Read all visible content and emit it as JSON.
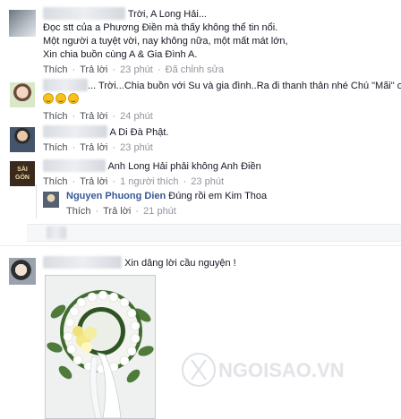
{
  "colors": {
    "link": "#365899",
    "meta": "#90949c",
    "action": "#4b4f56",
    "text": "#141823"
  },
  "comments": [
    {
      "lines": [
        "Trời, A Long Hải...",
        "Đọc stt của a Phương Điền mà thấy không thể tin nổi.",
        "Một người a tuyệt vời, nay không nữa, một mất mát lớn,",
        "Xin chia buồn cùng A & Gia Đình A."
      ],
      "like": "Thích",
      "reply": "Trả lời",
      "time": "23 phút",
      "edited": "Đã chỉnh sửa"
    },
    {
      "name_suffix": "...",
      "text": "Trời...Chia buồn với Su và gia đình..Ra đi thanh thản nhé Chú \"Mãi\" ơi",
      "emoji": [
        "laughing-emoji",
        "laughing-emoji",
        "laughing-emoji"
      ],
      "like": "Thích",
      "reply": "Trả lời",
      "time": "24 phút"
    },
    {
      "text": "A Di Đà Phật.",
      "like": "Thích",
      "reply": "Trả lời",
      "time": "23 phút"
    },
    {
      "avatar_text": "SÀI GÒN",
      "text": "Anh Long Hải phải không Anh Điền",
      "like": "Thích",
      "reply": "Trả lời",
      "replies_count": "1 người thích",
      "time": "23 phút"
    },
    {
      "name": "Nguyen Phuong Dien",
      "text": "Đúng rồi em Kim Thoa",
      "like": "Thích",
      "reply": "Trả lời",
      "time": "21 phút"
    },
    {
      "text": "Xin dâng lời cầu nguyện !",
      "photo": "funeral-wreath-photo"
    }
  ],
  "watermark": "NGOISAO.VN"
}
